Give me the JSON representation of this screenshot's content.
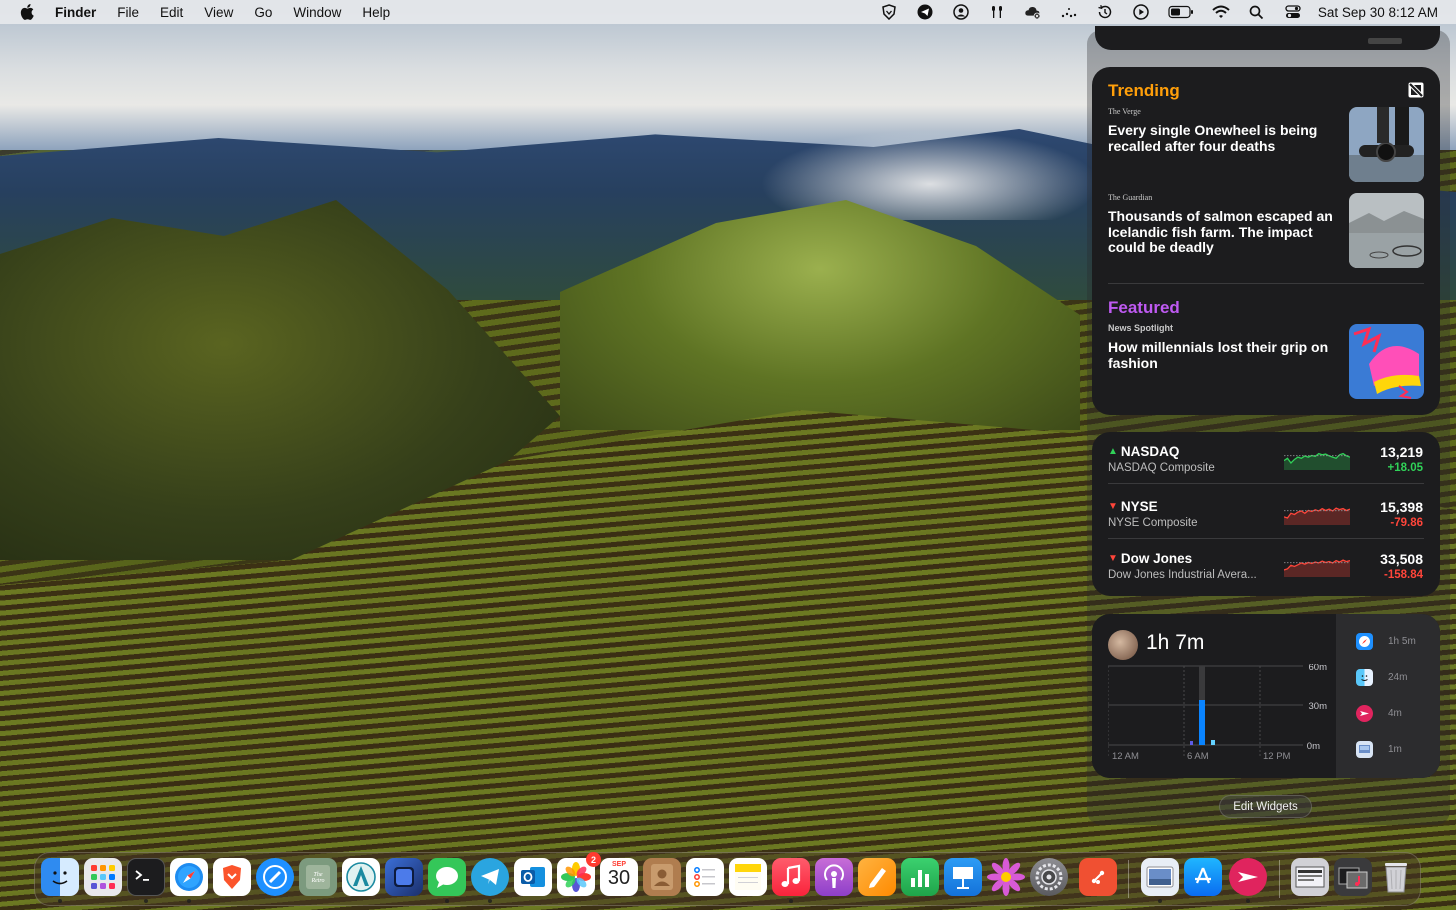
{
  "menubar": {
    "app_name": "Finder",
    "menus": [
      "File",
      "Edit",
      "View",
      "Go",
      "Window",
      "Help"
    ],
    "status_icons": [
      "brave-vpn-icon",
      "telegram-status-icon",
      "user-account-icon",
      "airpods-icon",
      "cloud-sync-icon",
      "activity-dots-icon",
      "time-machine-icon",
      "play-icon",
      "battery-icon",
      "wifi-icon",
      "search-icon",
      "control-center-icon"
    ],
    "clock": "Sat Sep 30  8:12 AM"
  },
  "news": {
    "trending_title": "Trending",
    "featured_title": "Featured",
    "stories": [
      {
        "source": "The Verge",
        "headline": "Every single Onewheel is being recalled after four deaths"
      },
      {
        "source": "The Guardian",
        "headline": "Thousands of salmon escaped an Icelandic fish farm. The impact could be deadly"
      },
      {
        "source": "News Spotlight",
        "headline": "How millennials lost their grip on fashion"
      }
    ],
    "colors": {
      "trending": "#ff9f0a",
      "featured": "#bf5af2"
    }
  },
  "stocks": [
    {
      "symbol": "NASDAQ",
      "name": "NASDAQ Composite",
      "price": "13,219",
      "change": "+18.05",
      "direction": "up",
      "color": "#30d158",
      "spark": [
        0.4,
        0.5,
        0.3,
        0.45,
        0.55,
        0.5,
        0.6,
        0.55,
        0.62,
        0.58,
        0.7,
        0.65,
        0.68,
        0.6,
        0.55,
        0.5,
        0.65,
        0.7,
        0.6,
        0.55
      ]
    },
    {
      "symbol": "NYSE",
      "name": "NYSE Composite",
      "price": "15,398",
      "change": "-79.86",
      "direction": "down",
      "color": "#ff453a",
      "spark": [
        0.35,
        0.3,
        0.5,
        0.45,
        0.55,
        0.6,
        0.5,
        0.62,
        0.58,
        0.65,
        0.6,
        0.7,
        0.62,
        0.68,
        0.6,
        0.72,
        0.66,
        0.7,
        0.62,
        0.68
      ]
    },
    {
      "symbol": "Dow Jones",
      "name": "Dow Jones Industrial Avera...",
      "price": "33,508",
      "change": "-158.84",
      "direction": "down",
      "color": "#ff453a",
      "spark": [
        0.3,
        0.35,
        0.5,
        0.45,
        0.52,
        0.6,
        0.55,
        0.62,
        0.58,
        0.64,
        0.6,
        0.68,
        0.62,
        0.66,
        0.6,
        0.7,
        0.64,
        0.72,
        0.66,
        0.7
      ]
    }
  ],
  "screentime": {
    "total": "1h 7m",
    "y_labels": [
      "60m",
      "30m",
      "0m"
    ],
    "x_labels": [
      "12 AM",
      "6 AM",
      "12 PM"
    ],
    "apps": [
      {
        "icon": "safari-icon",
        "time": "1h 5m",
        "color": "#1e90ff"
      },
      {
        "icon": "finder-icon",
        "time": "24m",
        "color": "#3aa0ff"
      },
      {
        "icon": "airmail-icon",
        "time": "4m",
        "color": "#e0245e"
      },
      {
        "icon": "preview-icon",
        "time": "1m",
        "color": "#6a8ec8"
      }
    ]
  },
  "edit_widgets_label": "Edit Widgets",
  "dock": {
    "calendar": {
      "month": "SEP",
      "day": "30"
    },
    "photos_badge": "2"
  }
}
